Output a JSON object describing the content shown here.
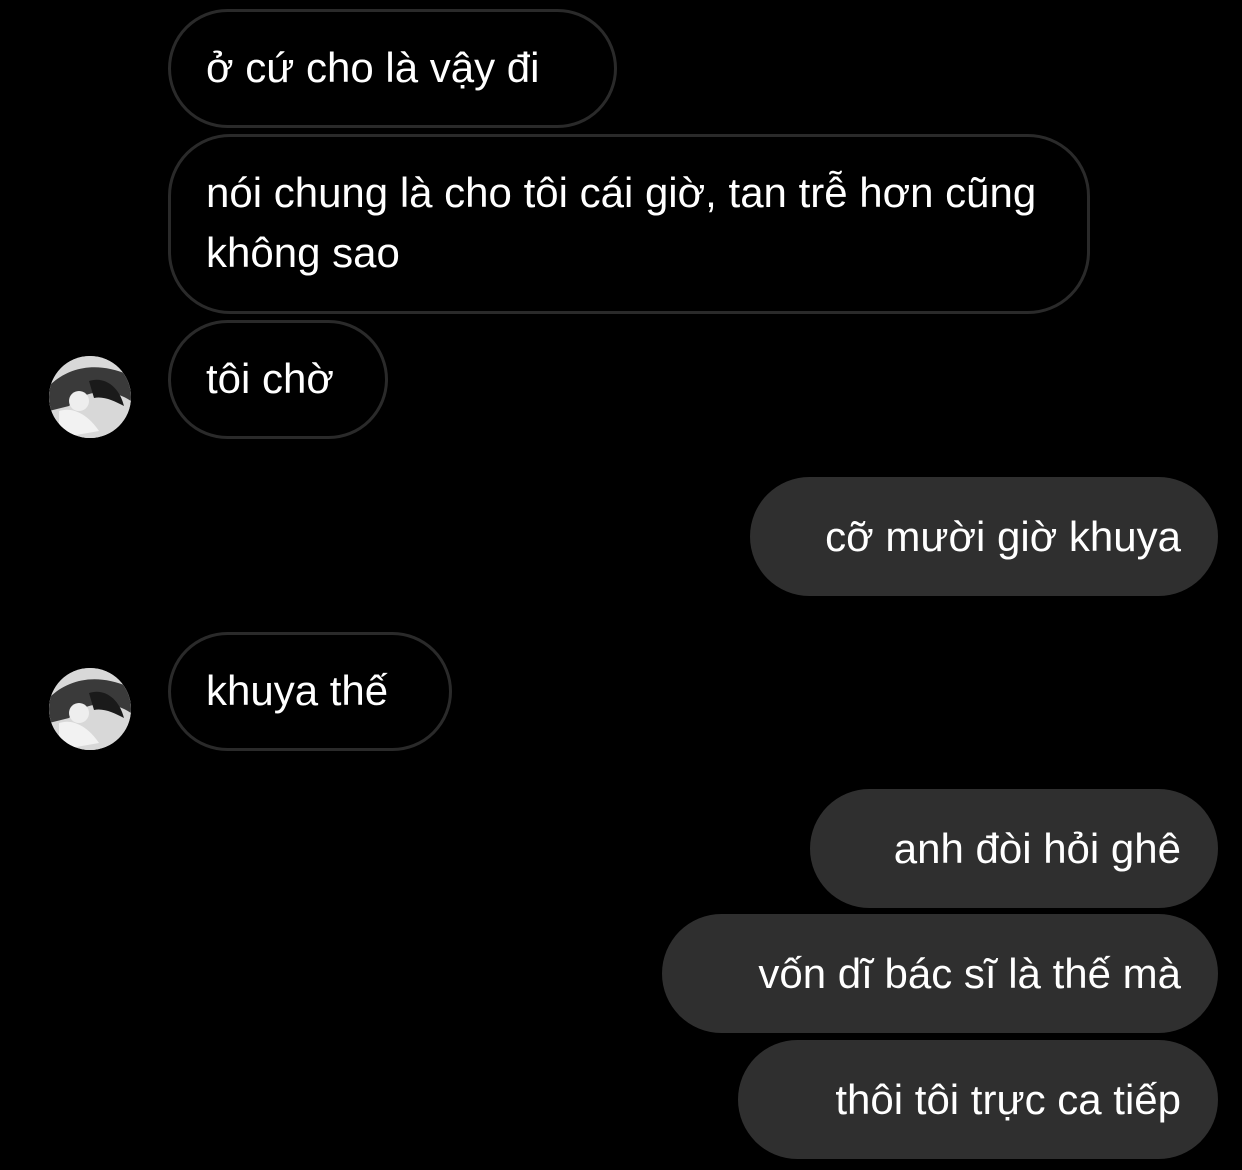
{
  "thread": {
    "messages": [
      {
        "side": "incoming",
        "text": "ở cứ cho là vậy đi"
      },
      {
        "side": "incoming",
        "text": "nói chung là cho tôi cái giờ, tan trễ hơn cũng không sao"
      },
      {
        "side": "incoming",
        "text": "tôi chờ",
        "avatar": "contact-avatar"
      },
      {
        "side": "outgoing",
        "text": "cỡ mười giờ khuya"
      },
      {
        "side": "incoming",
        "text": "khuya thế",
        "avatar": "contact-avatar"
      },
      {
        "side": "outgoing",
        "text": "anh đòi hỏi ghê"
      },
      {
        "side": "outgoing",
        "text": "vốn dĩ bác sĩ là thế mà"
      },
      {
        "side": "outgoing",
        "text": "thôi tôi trực ca tiếp"
      }
    ]
  },
  "colors": {
    "background": "#000000",
    "incoming_border": "#2a2a2a",
    "outgoing_fill": "#2f2f2f",
    "text": "#ffffff"
  }
}
